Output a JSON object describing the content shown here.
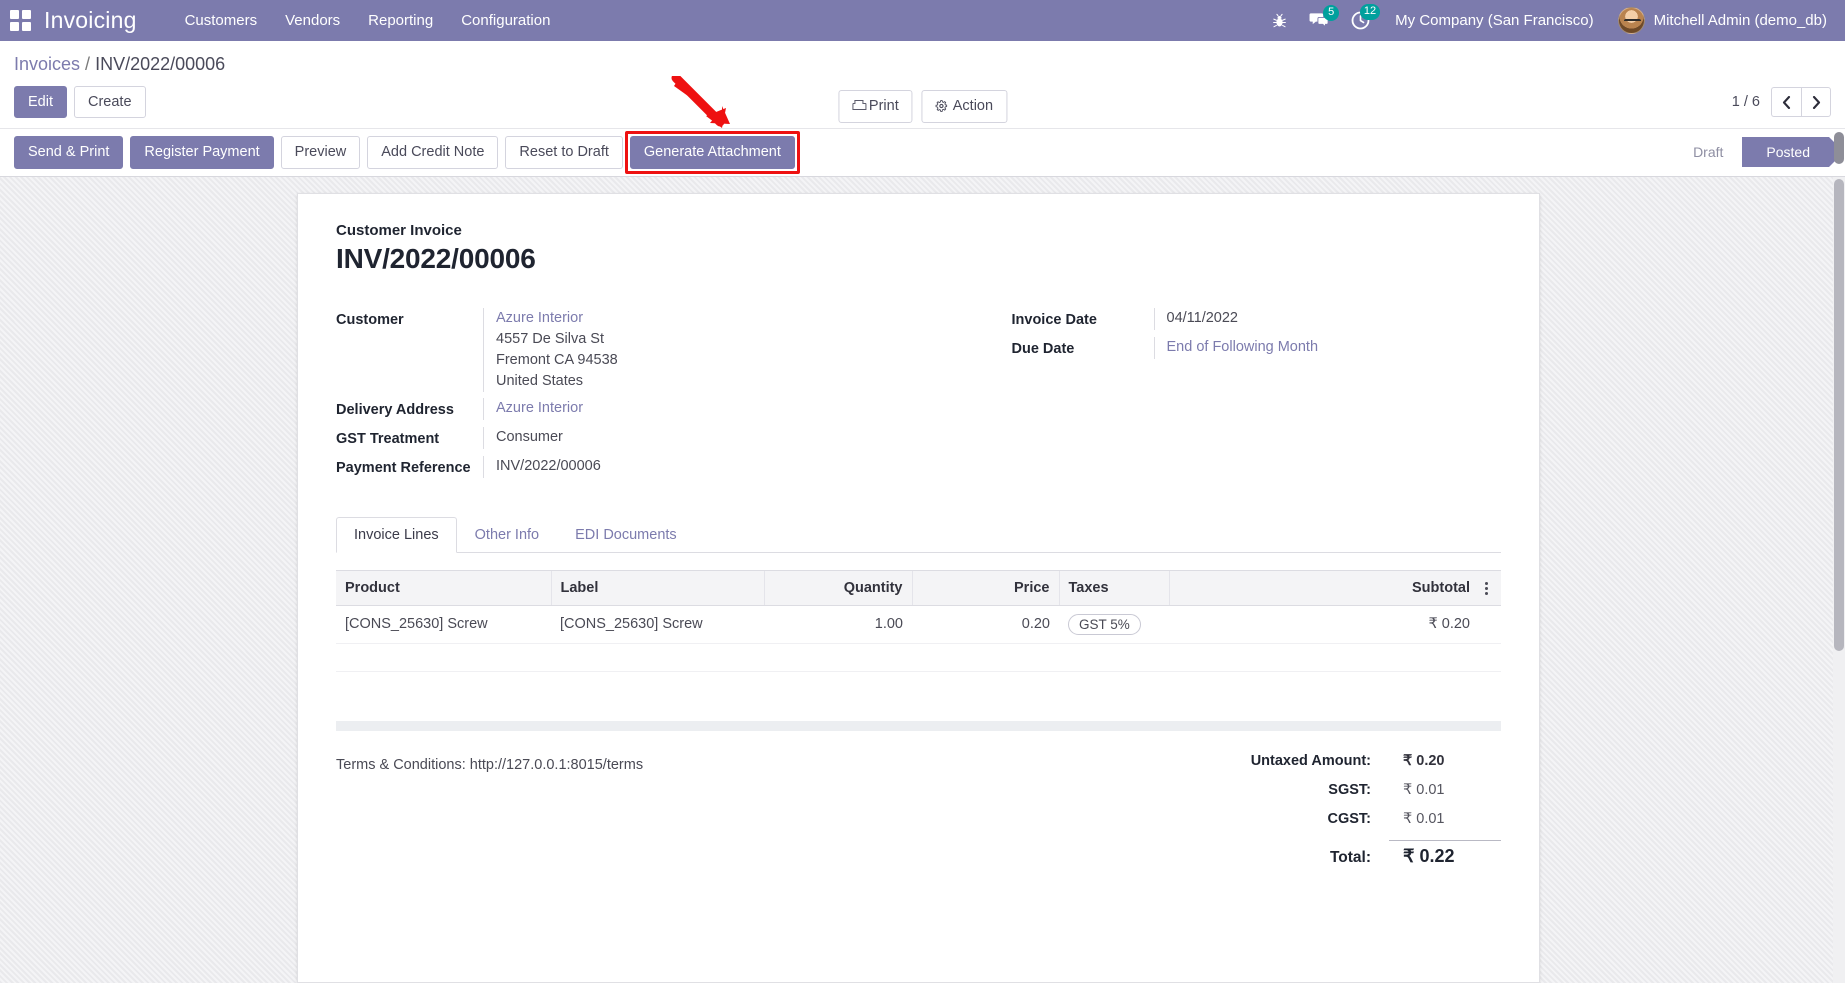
{
  "navbar": {
    "apps_icon": "apps-grid-icon",
    "brand": "Invoicing",
    "menus": [
      "Customers",
      "Vendors",
      "Reporting",
      "Configuration"
    ],
    "bug_icon": "bug-icon",
    "messages_icon": "messages-icon",
    "messages_count": "5",
    "activity_icon": "activity-clock-icon",
    "activity_count": "12",
    "company": "My Company (San Francisco)",
    "user": "Mitchell Admin (demo_db)",
    "accent": "#7C7BAD",
    "badge_color": "#00A09D"
  },
  "breadcrumb": {
    "parent": "Invoices",
    "separator": "/",
    "current": "INV/2022/00006"
  },
  "control_panel": {
    "edit_label": "Edit",
    "create_label": "Create",
    "print_label": "Print",
    "action_label": "Action",
    "pager_text": "1 / 6",
    "prev_icon": "chevron-left-icon",
    "next_icon": "chevron-right-icon"
  },
  "statusbar": {
    "buttons": [
      {
        "label": "Send & Print",
        "style": "primary"
      },
      {
        "label": "Register Payment",
        "style": "primary"
      },
      {
        "label": "Preview",
        "style": "secondary"
      },
      {
        "label": "Add Credit Note",
        "style": "secondary"
      },
      {
        "label": "Reset to Draft",
        "style": "secondary"
      },
      {
        "label": "Generate Attachment",
        "style": "primary",
        "highlighted": true
      }
    ],
    "stages": [
      {
        "label": "Draft",
        "active": false
      },
      {
        "label": "Posted",
        "active": true
      }
    ]
  },
  "annotation": {
    "highlight_target": "Generate Attachment",
    "highlight_color": "#ee1111",
    "arrow_color": "#ee1111"
  },
  "form": {
    "doc_type": "Customer Invoice",
    "doc_number": "INV/2022/00006",
    "left_fields": [
      {
        "label": "Customer",
        "value": "Azure Interior",
        "is_link": true,
        "extra_lines": [
          "4557 De Silva St",
          "Fremont CA 94538",
          "United States"
        ]
      },
      {
        "label": "Delivery Address",
        "value": "Azure Interior",
        "is_link": true,
        "extra_lines": []
      },
      {
        "label": "GST Treatment",
        "value": "Consumer",
        "is_link": false,
        "extra_lines": []
      },
      {
        "label": "Payment Reference",
        "value": "INV/2022/00006",
        "is_link": false,
        "extra_lines": []
      }
    ],
    "right_fields": [
      {
        "label": "Invoice Date",
        "value": "04/11/2022",
        "is_link": false
      },
      {
        "label": "Due Date",
        "value": "End of Following Month",
        "is_link": true
      }
    ]
  },
  "tabs": [
    {
      "label": "Invoice Lines",
      "active": true
    },
    {
      "label": "Other Info",
      "active": false
    },
    {
      "label": "EDI Documents",
      "active": false
    }
  ],
  "lines_table": {
    "columns": [
      "Product",
      "Label",
      "Quantity",
      "Price",
      "Taxes",
      "Subtotal"
    ],
    "options_icon": "vertical-dots-icon",
    "rows": [
      {
        "product": "[CONS_25630] Screw",
        "label": "[CONS_25630] Screw",
        "quantity": "1.00",
        "price": "0.20",
        "taxes": "GST 5%",
        "subtotal": "₹ 0.20"
      }
    ]
  },
  "footer": {
    "terms": "Terms & Conditions: http://127.0.0.1:8015/terms",
    "totals": [
      {
        "label": "Untaxed Amount:",
        "value": "₹ 0.20",
        "emphasis": "medium"
      },
      {
        "label": "SGST:",
        "value": "₹ 0.01",
        "emphasis": "small"
      },
      {
        "label": "CGST:",
        "value": "₹ 0.01",
        "emphasis": "small"
      },
      {
        "label": "Total:",
        "value": "₹ 0.22",
        "emphasis": "total"
      }
    ]
  }
}
